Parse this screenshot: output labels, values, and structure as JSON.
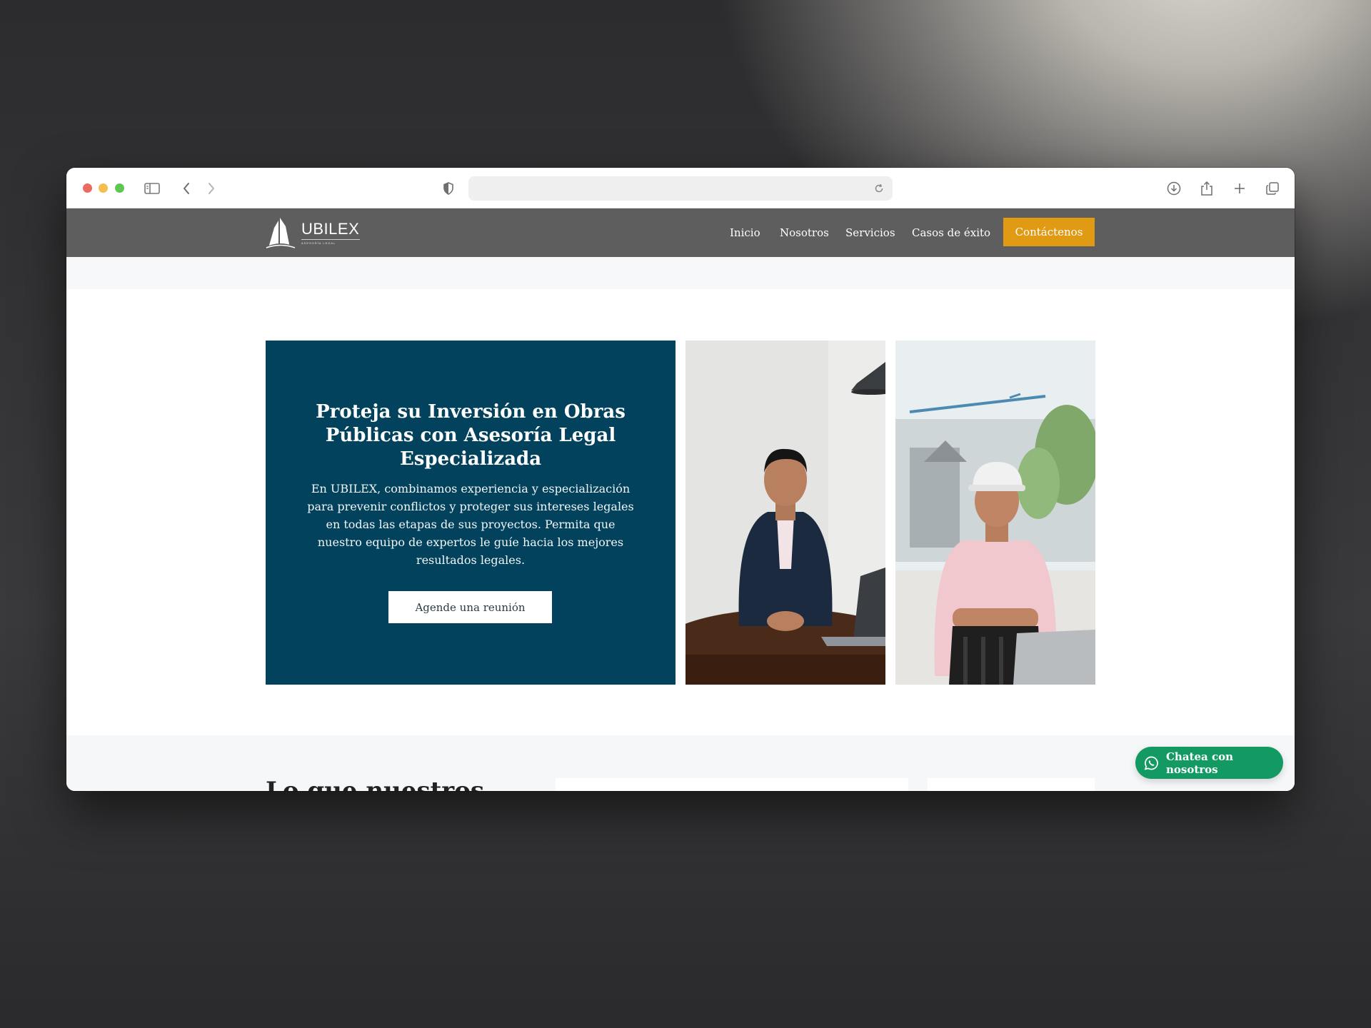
{
  "browser": {
    "url": "",
    "buttons": [
      "sidebar-toggle",
      "back",
      "forward",
      "privacy-shield",
      "reload",
      "downloads",
      "share",
      "new-tab",
      "tab-overview"
    ]
  },
  "site": {
    "logo": {
      "name": "UBILEX",
      "tagline": "ASESORÍA LEGAL"
    },
    "nav": {
      "items": [
        {
          "label": "Inicio"
        },
        {
          "label": "Nosotros"
        },
        {
          "label": "Servicios"
        },
        {
          "label": "Casos de éxito"
        }
      ],
      "cta": "Contáctenos"
    },
    "hero": {
      "title": "Proteja su Inversión en Obras Públicas con Asesoría Legal Especializada",
      "text": "En UBILEX, combinamos experiencia y especialización para prevenir conflictos y proteger sus intereses legales en todas las etapas de sus proyectos. Permita que nuestro equipo de expertos le guíe hacia los mejores resultados legales.",
      "button": "Agende una reunión"
    },
    "next_section": {
      "heading": "Lo que nuestros"
    },
    "chat": {
      "label": "Chatea con nosotros"
    },
    "colors": {
      "nav_bg": "#5e5e5e",
      "cta": "#e09a14",
      "hero_bg": "#02425c",
      "chat": "#139a62"
    }
  }
}
